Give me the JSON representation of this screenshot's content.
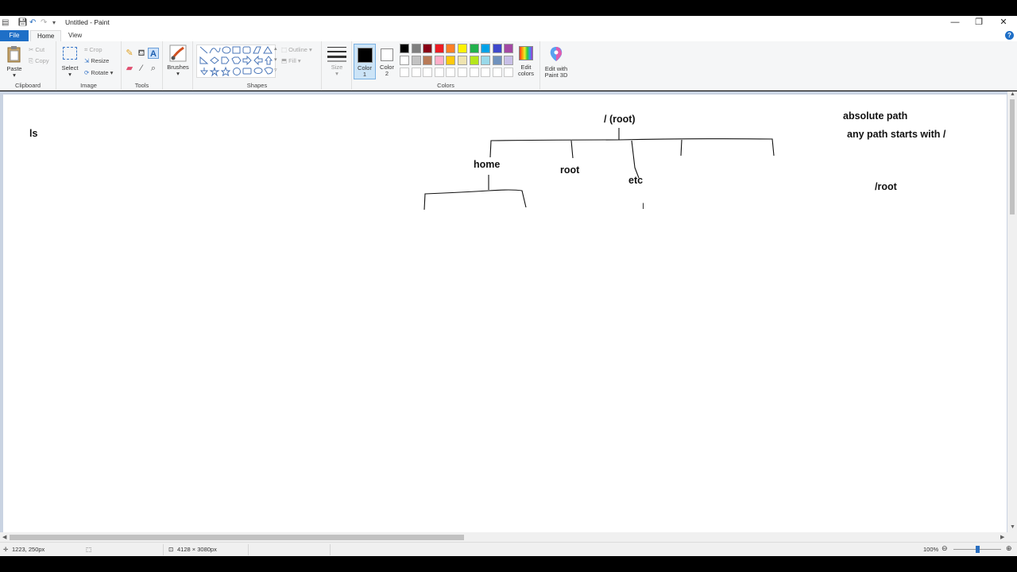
{
  "window": {
    "title": "Untitled - Paint",
    "controls": {
      "minimize": "—",
      "restore": "❐",
      "close": "✕"
    }
  },
  "tabs": {
    "file": "File",
    "home": "Home",
    "view": "View"
  },
  "ribbon": {
    "clipboard": {
      "paste": "Paste",
      "cut": "Cut",
      "copy": "Copy",
      "label": "Clipboard"
    },
    "image": {
      "select": "Select",
      "crop": "Crop",
      "resize": "Resize",
      "rotate": "Rotate",
      "label": "Image"
    },
    "tools": {
      "label": "Tools"
    },
    "brushes": {
      "label": "Brushes"
    },
    "shapes": {
      "outline": "Outline",
      "fill": "Fill",
      "label": "Shapes"
    },
    "size": {
      "label": "Size"
    },
    "color1": {
      "line1": "Color",
      "line2": "1",
      "color": "#000000"
    },
    "color2": {
      "line1": "Color",
      "line2": "2",
      "color": "#ffffff"
    },
    "colors": {
      "label": "Colors",
      "row1": [
        "#000000",
        "#7f7f7f",
        "#880015",
        "#ed1c24",
        "#ff7f27",
        "#fff200",
        "#22b14c",
        "#00a2e8",
        "#3f48cc",
        "#a349a4"
      ],
      "row2": [
        "#ffffff",
        "#c3c3c3",
        "#b97a57",
        "#ffaec9",
        "#ffc90e",
        "#efe4b0",
        "#b5e61d",
        "#99d9ea",
        "#7092be",
        "#c8bfe7"
      ]
    },
    "edit_colors": {
      "line1": "Edit",
      "line2": "colors"
    },
    "paint3d": {
      "line1": "Edit with",
      "line2": "Paint 3D"
    }
  },
  "canvas_text": {
    "ls": "ls",
    "root_node": "/ (root)",
    "home": "home",
    "root": "root",
    "etc": "etc",
    "absolute_path": "absolute path",
    "starts_with": "any path starts with /",
    "root_path": "/root"
  },
  "status": {
    "cursor_pos": "1223, 250px",
    "image_size": "4128 × 3080px",
    "zoom": "100%"
  }
}
